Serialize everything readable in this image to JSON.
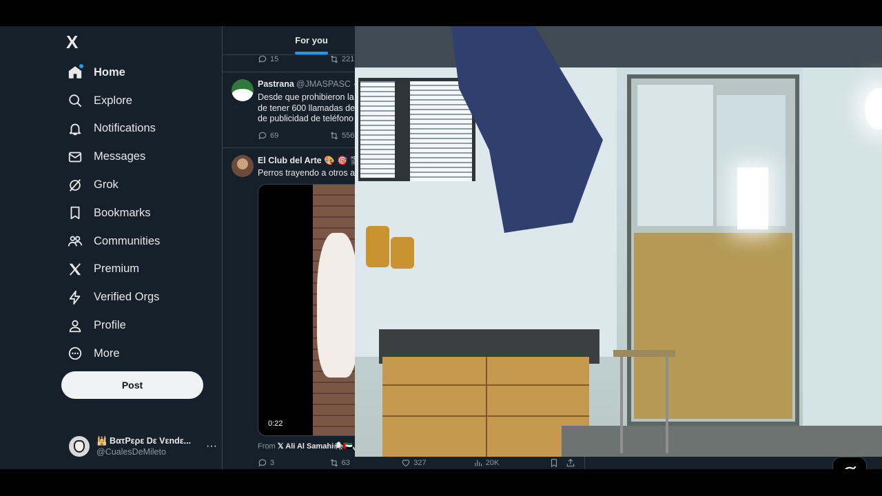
{
  "sidebar": {
    "logo": "X",
    "items": [
      {
        "label": "Home",
        "icon": "home-icon",
        "active": true
      },
      {
        "label": "Explore",
        "icon": "search-icon"
      },
      {
        "label": "Notifications",
        "icon": "bell-icon"
      },
      {
        "label": "Messages",
        "icon": "envelope-icon"
      },
      {
        "label": "Grok",
        "icon": "grok-icon"
      },
      {
        "label": "Bookmarks",
        "icon": "bookmark-icon"
      },
      {
        "label": "Communities",
        "icon": "communities-icon"
      },
      {
        "label": "Premium",
        "icon": "x-logo-icon"
      },
      {
        "label": "Verified Orgs",
        "icon": "lightning-icon"
      },
      {
        "label": "Profile",
        "icon": "person-icon"
      },
      {
        "label": "More",
        "icon": "more-circle-icon"
      }
    ],
    "post_label": "Post",
    "account": {
      "name": "🕌 BατPερε Dε Vεndε...",
      "handle": "@CualesDeMileto",
      "more": "···"
    }
  },
  "timeline": {
    "tab": "For you",
    "prev_tweet": {
      "replies": "15",
      "reposts": "221"
    },
    "tweets": [
      {
        "name": "Pastrana",
        "handle": "@JMASPASC ·",
        "lines": [
          "Desde que prohibieron la",
          "de tener 600 llamadas de",
          "de publicidad de teléfono"
        ],
        "replies": "69",
        "reposts": "556"
      },
      {
        "name": "El Club del Arte 🎨 🎯 🎬",
        "handle": "",
        "lines": [
          "Perros trayendo a otros a"
        ],
        "duration": "0:22",
        "from_prefix": "From",
        "from_name": "𝕏 Ali Al Samahi🕷🇦🇪علي السماحي",
        "replies": "3",
        "reposts": "63",
        "likes": "327",
        "views": "20K"
      }
    ]
  },
  "colors": {
    "background": "#15202b",
    "accent": "#1d9bf0",
    "border": "#38444d",
    "muted": "#8b98a5"
  }
}
